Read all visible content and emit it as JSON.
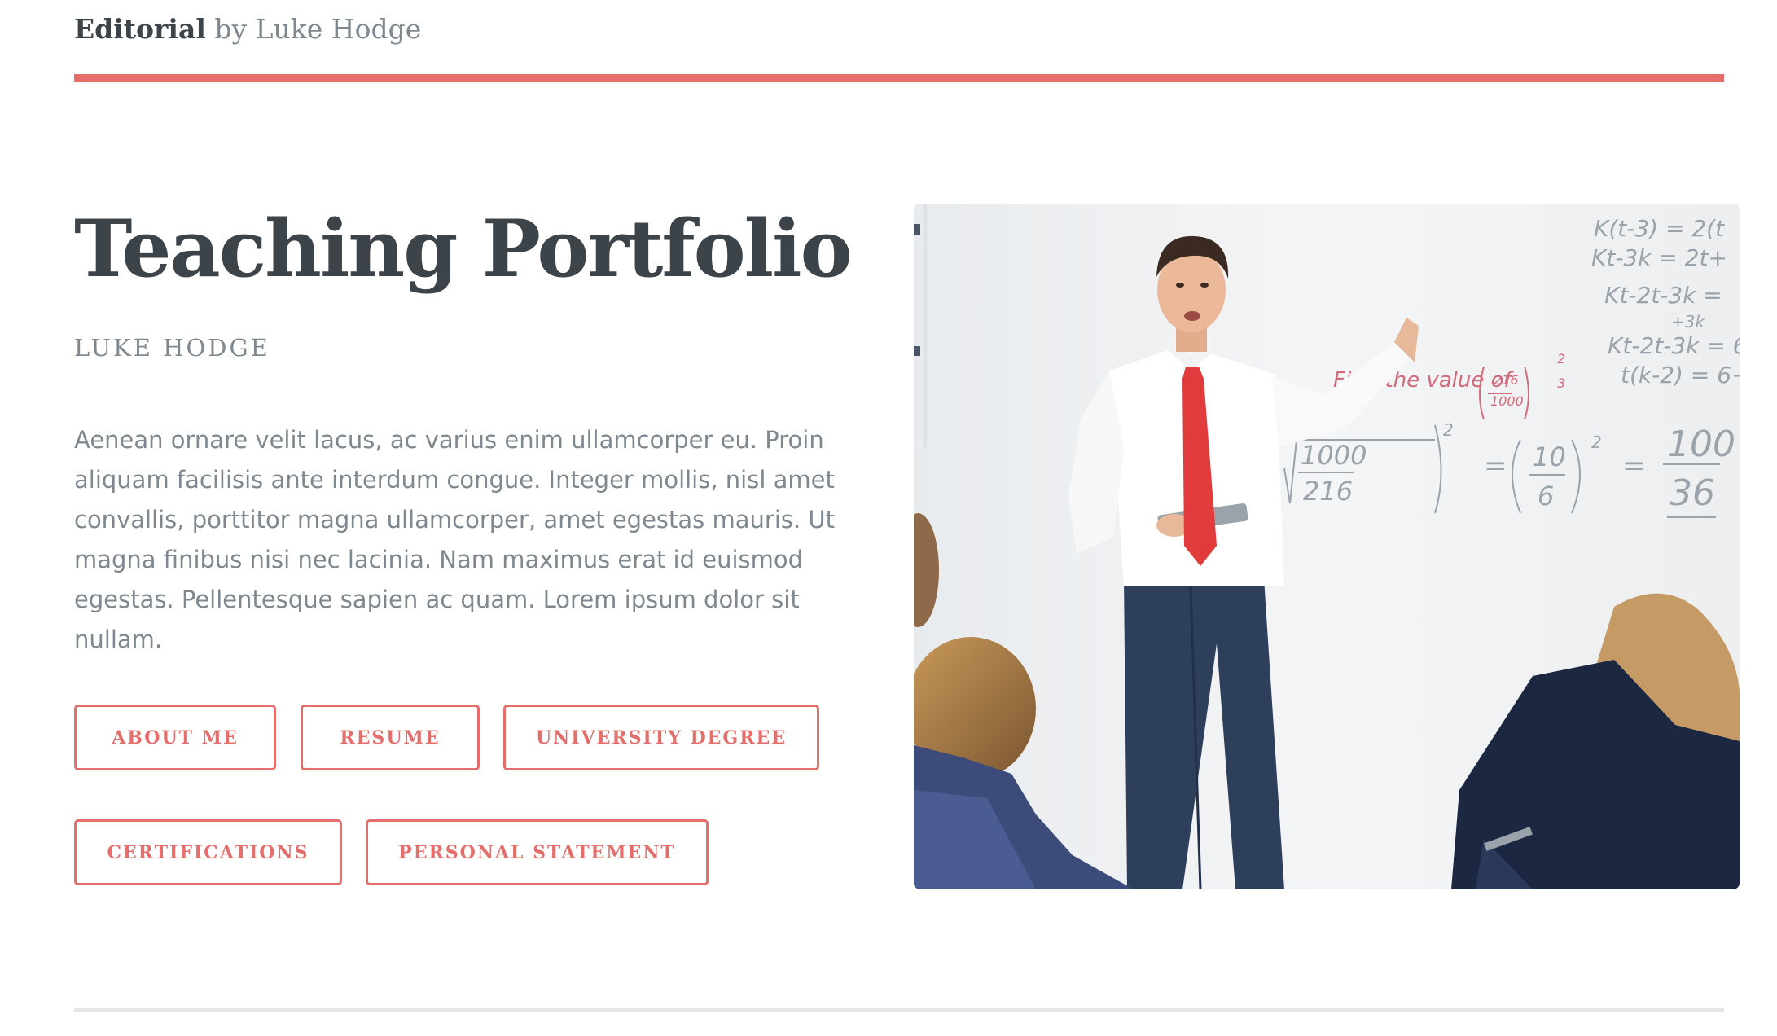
{
  "header": {
    "brand": "Editorial",
    "byline": "by Luke Hodge"
  },
  "hero": {
    "title": "Teaching Portfolio",
    "subtitle": "LUKE HODGE",
    "body": "Aenean ornare velit lacus, ac varius enim ullamcorper eu. Proin aliquam facilisis ante interdum congue. Integer mollis, nisl amet convallis, porttitor magna ullamcorper, amet egestas mauris. Ut magna finibus nisi nec lacinia. Nam maximus erat id euismod egestas. Pellentesque sapien ac quam. Lorem ipsum dolor sit nullam.",
    "buttons": [
      {
        "label": "ABOUT ME"
      },
      {
        "label": "RESUME"
      },
      {
        "label": "UNIVERSITY DEGREE"
      },
      {
        "label": "CERTIFICATIONS"
      },
      {
        "label": "PERSONAL STATEMENT"
      }
    ],
    "image_whiteboard": {
      "line1": "K(t-3) = 2(t",
      "line2": "Kt-3k = 2t+",
      "line3": "Kt-2t-3k =",
      "line4": "+3k",
      "line5": "Kt-2t-3k = 6",
      "line6": "t(k-2) = 6+",
      "line7": "Find the value of",
      "frac1_num": "216",
      "frac1_den": "1000",
      "exp1_num": "2",
      "exp1_den": "3",
      "root_num": "1000",
      "root_den": "216",
      "exp2": "2",
      "frac2_num": "10",
      "frac2_den": "6",
      "exp3": "2",
      "frac3_num": "100",
      "frac3_den": "36"
    }
  },
  "colors": {
    "accent": "#e36e6c",
    "heading": "#3d4449",
    "text": "#7f888f",
    "rule": "#e4e6e8"
  }
}
